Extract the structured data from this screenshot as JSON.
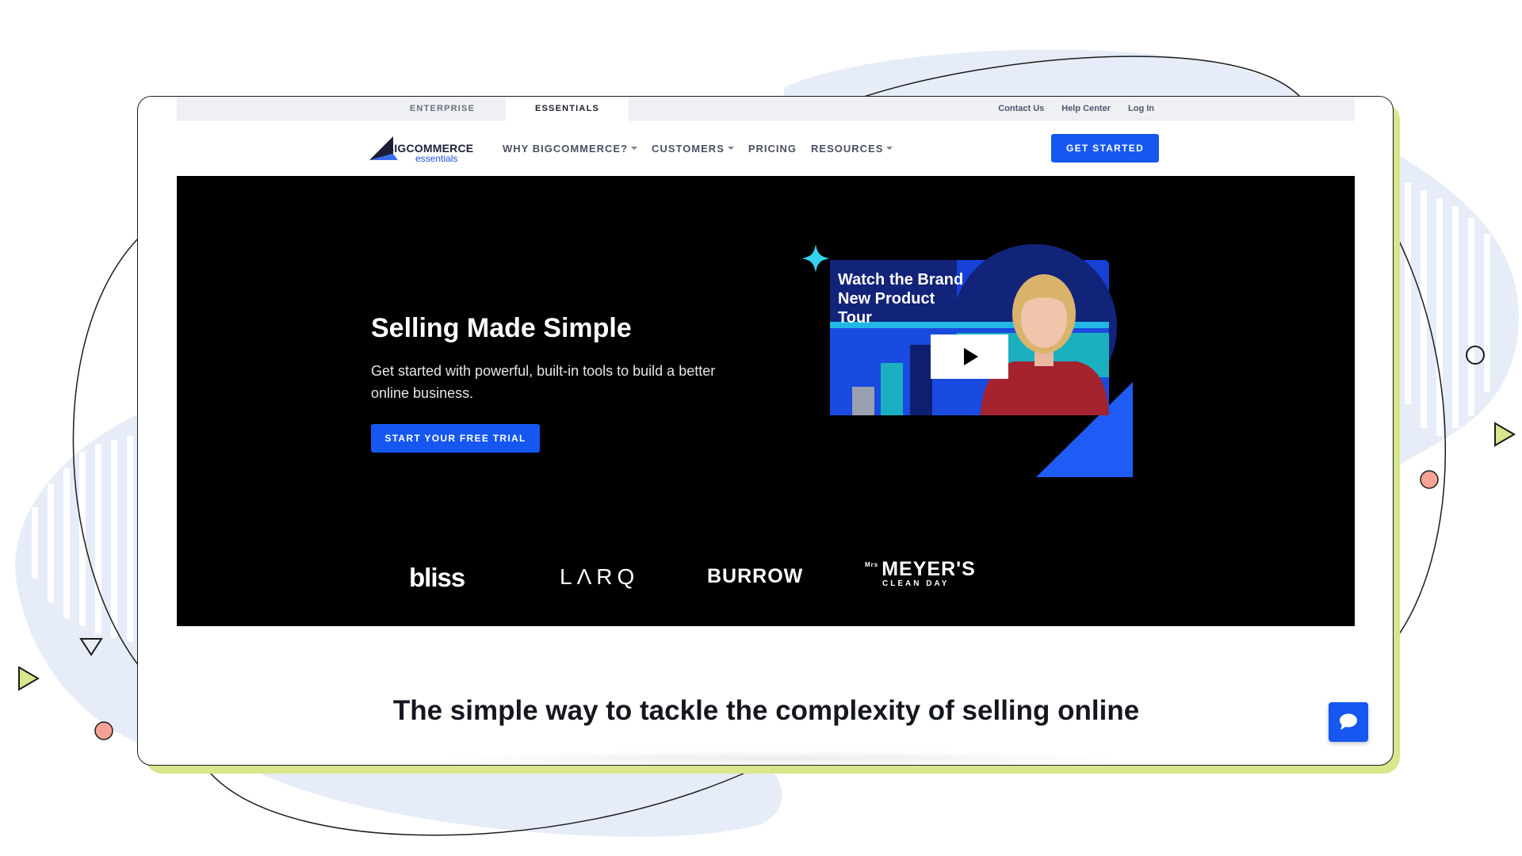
{
  "utility_bar": {
    "tabs": [
      {
        "label": "ENTERPRISE",
        "active": false
      },
      {
        "label": "ESSENTIALS",
        "active": true
      }
    ],
    "links": [
      "Contact Us",
      "Help Center",
      "Log In"
    ]
  },
  "nav": {
    "logo": {
      "text_main": "BIGCOMMERCE",
      "text_sub": "essentials"
    },
    "menu": [
      {
        "label": "WHY BIGCOMMERCE?",
        "has_dropdown": true
      },
      {
        "label": "CUSTOMERS",
        "has_dropdown": true
      },
      {
        "label": "PRICING",
        "has_dropdown": false
      },
      {
        "label": "RESOURCES",
        "has_dropdown": true
      }
    ],
    "cta": "GET STARTED"
  },
  "hero": {
    "title": "Selling Made Simple",
    "subtitle": "Get started with powerful, built-in tools to build a better online business.",
    "cta": "START YOUR FREE TRIAL",
    "video": {
      "title": "Watch the Brand New Product Tour",
      "play_icon": "play-icon"
    }
  },
  "brands": {
    "bliss": "bliss",
    "larq": "LΛRQ",
    "burrow": "BURROW",
    "meyers_prefix": "Mrs",
    "meyers_name": "MEYER'S",
    "meyers_sub": "CLEAN DAY"
  },
  "section": {
    "tagline": "The simple way to tackle the complexity of selling online"
  },
  "chat": {
    "icon": "chat-bubble-icon"
  },
  "colors": {
    "accent": "#1557F0",
    "hero_bg": "#000000",
    "frame_shadow": "#D8E68C",
    "deco_blob": "#E6EDF8"
  }
}
